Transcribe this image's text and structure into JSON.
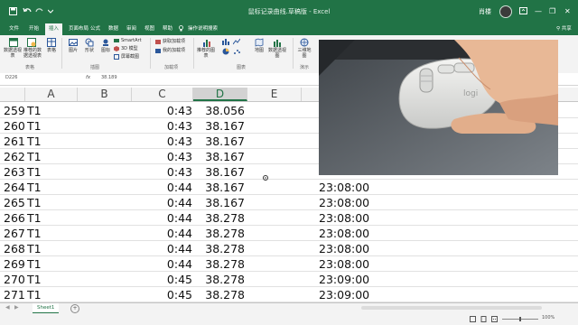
{
  "titlebar": {
    "title": "鼠标记录曲线.草稿版 - Excel",
    "user": "肖楼",
    "undo_icon": "undo-icon",
    "save_icon": "save-icon",
    "minimize": "—",
    "restore": "❐",
    "close": "✕"
  },
  "tabs": [
    "文件",
    "开始",
    "插入",
    "页面布局",
    "公式",
    "数据",
    "审阅",
    "视图",
    "帮助",
    "操作说明搜索"
  ],
  "active_tab": "插入",
  "share": "共享",
  "ribbon": {
    "buttons": [
      "数据透视表",
      "推荐的数据透视表",
      "表格",
      "图片",
      "形状",
      "图标",
      "SmartArt",
      "3D 模型",
      "屏幕截图",
      "获取加载项",
      "我的加载项",
      "推荐的图表",
      "地图",
      "数据透视图",
      "三维地图"
    ],
    "groups": [
      "表格",
      "插图",
      "加载项",
      "图表",
      "演示"
    ]
  },
  "formula_bar": {
    "name_box": "D226",
    "fx": "fx",
    "formula": "38.189"
  },
  "columns": [
    "A",
    "B",
    "C",
    "D",
    "E"
  ],
  "selected_column": "D",
  "rows": [
    {
      "n": "259",
      "a": "T1",
      "c": "0:43",
      "d": "38.056",
      "f": ""
    },
    {
      "n": "260",
      "a": "T1",
      "c": "0:43",
      "d": "38.167",
      "f": ""
    },
    {
      "n": "261",
      "a": "T1",
      "c": "0:43",
      "d": "38.167",
      "f": ""
    },
    {
      "n": "262",
      "a": "T1",
      "c": "0:43",
      "d": "38.167",
      "f": ""
    },
    {
      "n": "263",
      "a": "T1",
      "c": "0:43",
      "d": "38.167",
      "f": ""
    },
    {
      "n": "264",
      "a": "T1",
      "c": "0:44",
      "d": "38.167",
      "f": "23:08:00"
    },
    {
      "n": "265",
      "a": "T1",
      "c": "0:44",
      "d": "38.167",
      "f": "23:08:00"
    },
    {
      "n": "266",
      "a": "T1",
      "c": "0:44",
      "d": "38.278",
      "f": "23:08:00"
    },
    {
      "n": "267",
      "a": "T1",
      "c": "0:44",
      "d": "38.278",
      "f": "23:08:00"
    },
    {
      "n": "268",
      "a": "T1",
      "c": "0:44",
      "d": "38.278",
      "f": "23:08:00"
    },
    {
      "n": "269",
      "a": "T1",
      "c": "0:44",
      "d": "38.278",
      "f": "23:08:00"
    },
    {
      "n": "270",
      "a": "T1",
      "c": "0:45",
      "d": "38.278",
      "f": "23:09:00"
    },
    {
      "n": "271",
      "a": "T1",
      "c": "0:45",
      "d": "38.278",
      "f": "23:09:00"
    }
  ],
  "sheet_tab": "Sheet1",
  "add_sheet": "+",
  "photo": {
    "logo": "logi",
    "icon": "mouse-photo"
  },
  "status": {
    "zoom": "100%"
  },
  "colors": {
    "excel_green": "#217346",
    "ribbon_bg": "#f3f3f3"
  }
}
